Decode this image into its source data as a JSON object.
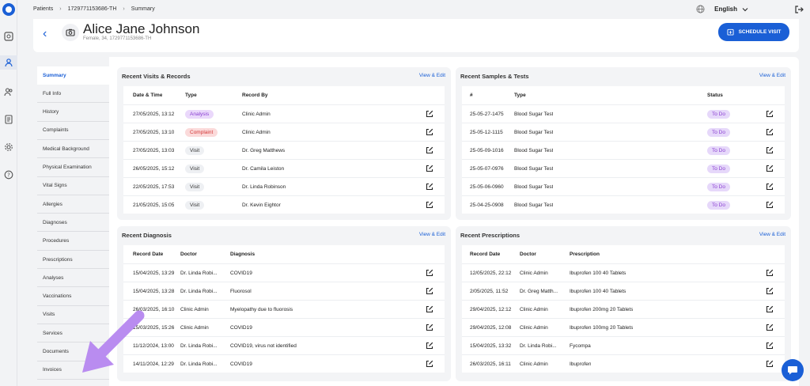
{
  "breadcrumb": {
    "items": [
      "Patients",
      "1729771153686-TH",
      "Summary"
    ]
  },
  "top": {
    "language": "English"
  },
  "patient": {
    "name": "Alice Jane Johnson",
    "sub": "Female, 34, 1729771153686-TH"
  },
  "header": {
    "schedule_label": "SCHEDULE VISIT"
  },
  "nav": [
    "Summary",
    "Full Info",
    "History",
    "Complaints",
    "Medical Background",
    "Physical Examination",
    "Vital Signs",
    "Allergies",
    "Diagnoses",
    "Procedures",
    "Prescriptions",
    "Analyses",
    "Vaccinations",
    "Visits",
    "Services",
    "Documents",
    "Invoices"
  ],
  "visits": {
    "title": "Recent Visits & Records",
    "link": "View & Edit",
    "headers": [
      "Date & Time",
      "Type",
      "Record By"
    ],
    "rows": [
      {
        "date": "27/05/2025, 13:12",
        "type": "Analysis",
        "kind": "analysis",
        "by": "Clinic Admin"
      },
      {
        "date": "27/05/2025, 13:10",
        "type": "Complaint",
        "kind": "complaint",
        "by": "Clinic Admin"
      },
      {
        "date": "27/05/2025, 13:03",
        "type": "Visit",
        "kind": "visit",
        "by": "Dr. Greg Matthews"
      },
      {
        "date": "26/05/2025, 15:12",
        "type": "Visit",
        "kind": "visit",
        "by": "Dr. Camila Leiston"
      },
      {
        "date": "22/05/2025, 17:53",
        "type": "Visit",
        "kind": "visit",
        "by": "Dr. Linda Robinson"
      },
      {
        "date": "21/05/2025, 15:05",
        "type": "Visit",
        "kind": "visit",
        "by": "Dr. Kevin Eightor"
      }
    ]
  },
  "samples": {
    "title": "Recent Samples & Tests",
    "link": "View & Edit",
    "headers": [
      "#",
      "Type",
      "Status"
    ],
    "rows": [
      {
        "id": "25-05-27-1475",
        "type": "Blood Sugar Test",
        "status": "To Do"
      },
      {
        "id": "25-05-12-1115",
        "type": "Blood Sugar Test",
        "status": "To Do"
      },
      {
        "id": "25-05-09-1016",
        "type": "Blood Sugar Test",
        "status": "To Do"
      },
      {
        "id": "25-05-07-0976",
        "type": "Blood Sugar Test",
        "status": "To Do"
      },
      {
        "id": "25-05-06-0960",
        "type": "Blood Sugar Test",
        "status": "To Do"
      },
      {
        "id": "25-04-25-0908",
        "type": "Blood Sugar Test",
        "status": "To Do"
      }
    ]
  },
  "diagnosis": {
    "title": "Recent Diagnosis",
    "link": "View & Edit",
    "headers": [
      "Record Date",
      "Doctor",
      "Diagnosis"
    ],
    "rows": [
      {
        "date": "15/04/2025, 13:29",
        "doctor": "Dr. Linda Robi...",
        "diag": "COVID19"
      },
      {
        "date": "15/04/2025, 13:28",
        "doctor": "Dr. Linda Robi...",
        "diag": "Fluorosol"
      },
      {
        "date": "26/03/2025, 16:10",
        "doctor": "Clinic Admin",
        "diag": "Myelopathy due to fluorosis"
      },
      {
        "date": "15/03/2025, 15:26",
        "doctor": "Clinic Admin",
        "diag": "COVID19"
      },
      {
        "date": "11/12/2024, 13:00",
        "doctor": "Dr. Linda Robi...",
        "diag": "COVID19, virus not identified"
      },
      {
        "date": "14/11/2024, 12:29",
        "doctor": "Dr. Linda Robi...",
        "diag": "COVID19"
      }
    ]
  },
  "prescriptions": {
    "title": "Recent Prescriptions",
    "link": "View & Edit",
    "headers": [
      "Record Date",
      "Doctor",
      "Prescription"
    ],
    "rows": [
      {
        "date": "12/05/2025, 22:12",
        "doctor": "Clinic Admin",
        "rx": "Ibuprofen 100 40 Tablets"
      },
      {
        "date": "2/05/2025, 11:52",
        "doctor": "Dr. Greg Matth...",
        "rx": "Ibuprofen 100 40 Tablets"
      },
      {
        "date": "29/04/2025, 12:12",
        "doctor": "Clinic Admin",
        "rx": "Ibuprofen 200mg 20 Tablets"
      },
      {
        "date": "29/04/2025, 12:08",
        "doctor": "Clinic Admin",
        "rx": "Ibuprofen 100mg 20 Tablets"
      },
      {
        "date": "15/04/2025, 13:32",
        "doctor": "Dr. Linda Robi...",
        "rx": "Fycompa"
      },
      {
        "date": "26/03/2025, 16:11",
        "doctor": "Clinic Admin",
        "rx": "Ibuprofen"
      }
    ]
  },
  "colors": {
    "accent": "#1a5fd6",
    "arrow": "#b98cf0",
    "todo_bg": "#e6d8fa"
  }
}
